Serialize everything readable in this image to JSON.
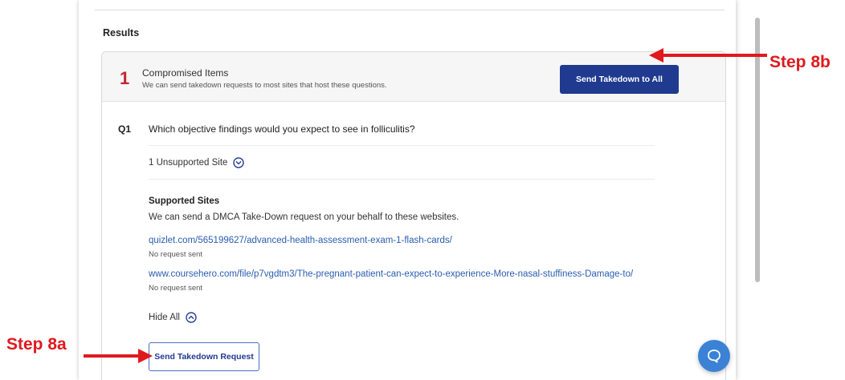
{
  "results": {
    "title": "Results"
  },
  "summary": {
    "count": "1",
    "title": "Compromised Items",
    "subtitle": "We can send takedown requests to most sites that host these questions.",
    "send_all_label": "Send Takedown to All"
  },
  "question": {
    "label": "Q1",
    "text": "Which objective findings would you expect to see in folliculitis?",
    "unsupported_text": "1 Unsupported Site",
    "supported_title": "Supported Sites",
    "supported_desc": "We can send a DMCA Take-Down request on your behalf to these websites.",
    "sites": [
      {
        "url": "quizlet.com/565199627/advanced-health-assessment-exam-1-flash-cards/",
        "status": "No request sent"
      },
      {
        "url": "www.coursehero.com/file/p7vgdtm3/The-pregnant-patient-can-expect-to-experience-More-nasal-stuffiness-Damage-to/",
        "status": "No request sent"
      }
    ],
    "hide_all_label": "Hide All",
    "send_request_label": "Send Takedown Request"
  },
  "annotations": {
    "step_8a": "Step 8a",
    "step_8b": "Step 8b"
  },
  "icons": {
    "chevron_down": "chevron-down-circle-icon",
    "chevron_up": "chevron-up-circle-icon",
    "chat": "chat-bubble-icon"
  },
  "colors": {
    "primary_button": "#1f3a8f",
    "link": "#2a5db0",
    "count_red": "#c0282d",
    "annotation_red": "#e0191e",
    "chat_blue": "#3b82d6"
  }
}
